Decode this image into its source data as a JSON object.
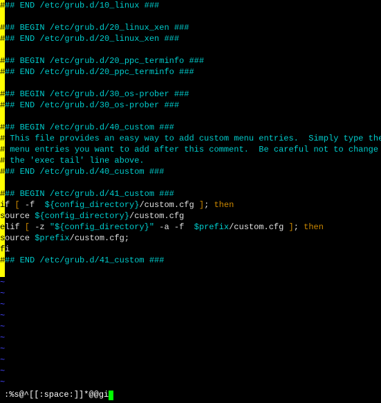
{
  "lines": [
    {
      "hl": "#",
      "seg": [
        {
          "c": "cyan",
          "t": "## END /etc/grub.d/10_linux ###"
        }
      ]
    },
    {
      "hl": " ",
      "seg": []
    },
    {
      "hl": "#",
      "seg": [
        {
          "c": "cyan",
          "t": "## BEGIN /etc/grub.d/20_linux_xen ###"
        }
      ]
    },
    {
      "hl": "#",
      "seg": [
        {
          "c": "cyan",
          "t": "## END /etc/grub.d/20_linux_xen ###"
        }
      ]
    },
    {
      "hl": " ",
      "seg": []
    },
    {
      "hl": "#",
      "seg": [
        {
          "c": "cyan",
          "t": "## BEGIN /etc/grub.d/20_ppc_terminfo ###"
        }
      ]
    },
    {
      "hl": "#",
      "seg": [
        {
          "c": "cyan",
          "t": "## END /etc/grub.d/20_ppc_terminfo ###"
        }
      ]
    },
    {
      "hl": " ",
      "seg": []
    },
    {
      "hl": "#",
      "seg": [
        {
          "c": "cyan",
          "t": "## BEGIN /etc/grub.d/30_os-prober ###"
        }
      ]
    },
    {
      "hl": "#",
      "seg": [
        {
          "c": "cyan",
          "t": "## END /etc/grub.d/30_os-prober ###"
        }
      ]
    },
    {
      "hl": " ",
      "seg": []
    },
    {
      "hl": "#",
      "seg": [
        {
          "c": "cyan",
          "t": "## BEGIN /etc/grub.d/40_custom ###"
        }
      ]
    },
    {
      "hl": "#",
      "seg": [
        {
          "c": "cyan",
          "t": " This file provides an easy way to add custom menu entries.  Simply type the"
        }
      ]
    },
    {
      "hl": "#",
      "seg": [
        {
          "c": "cyan",
          "t": " menu entries you want to add after this comment.  Be careful not to change"
        }
      ]
    },
    {
      "hl": "#",
      "seg": [
        {
          "c": "cyan",
          "t": " the 'exec tail' line above."
        }
      ]
    },
    {
      "hl": "#",
      "seg": [
        {
          "c": "cyan",
          "t": "## END /etc/grub.d/40_custom ###"
        }
      ]
    },
    {
      "hl": " ",
      "seg": []
    },
    {
      "hl": "#",
      "seg": [
        {
          "c": "cyan",
          "t": "## BEGIN /etc/grub.d/41_custom ###"
        }
      ]
    },
    {
      "hl": "i",
      "seg": [
        {
          "c": "white",
          "t": "f"
        },
        {
          "c": "brown",
          "t": " [ "
        },
        {
          "c": "white",
          "t": "-f  "
        },
        {
          "c": "cyan",
          "t": "${config_directory}"
        },
        {
          "c": "white",
          "t": "/custom.cfg"
        },
        {
          "c": "brown",
          "t": " ]"
        },
        {
          "c": "white",
          "t": ";"
        },
        {
          "c": "brown",
          "t": " then"
        }
      ]
    },
    {
      "hl": "s",
      "seg": [
        {
          "c": "white",
          "t": "ource "
        },
        {
          "c": "cyan",
          "t": "${config_directory}"
        },
        {
          "c": "white",
          "t": "/custom.cfg"
        }
      ]
    },
    {
      "hl": "e",
      "seg": [
        {
          "c": "white",
          "t": "lif"
        },
        {
          "c": "brown",
          "t": " [ "
        },
        {
          "c": "white",
          "t": "-z "
        },
        {
          "c": "cyan",
          "t": "\"${config_directory}\""
        },
        {
          "c": "white",
          "t": " -a -f  "
        },
        {
          "c": "cyan",
          "t": "$prefix"
        },
        {
          "c": "white",
          "t": "/custom.cfg"
        },
        {
          "c": "brown",
          "t": " ]"
        },
        {
          "c": "white",
          "t": ";"
        },
        {
          "c": "brown",
          "t": " then"
        }
      ]
    },
    {
      "hl": "s",
      "seg": [
        {
          "c": "white",
          "t": "ource "
        },
        {
          "c": "cyan",
          "t": "$prefix"
        },
        {
          "c": "white",
          "t": "/custom.cfg;"
        }
      ]
    },
    {
      "hl": "f",
      "seg": [
        {
          "c": "white",
          "t": "i"
        }
      ]
    },
    {
      "hl": "#",
      "seg": [
        {
          "c": "cyan",
          "t": "## END /etc/grub.d/41_custom ###"
        }
      ]
    },
    {
      "hl": " ",
      "seg": []
    }
  ],
  "tildes": [
    "~",
    "~",
    "~",
    "~",
    "~",
    "~",
    "~",
    "~",
    "~",
    "~"
  ],
  "command": ":%s@^[[:space:]]*@@gi"
}
